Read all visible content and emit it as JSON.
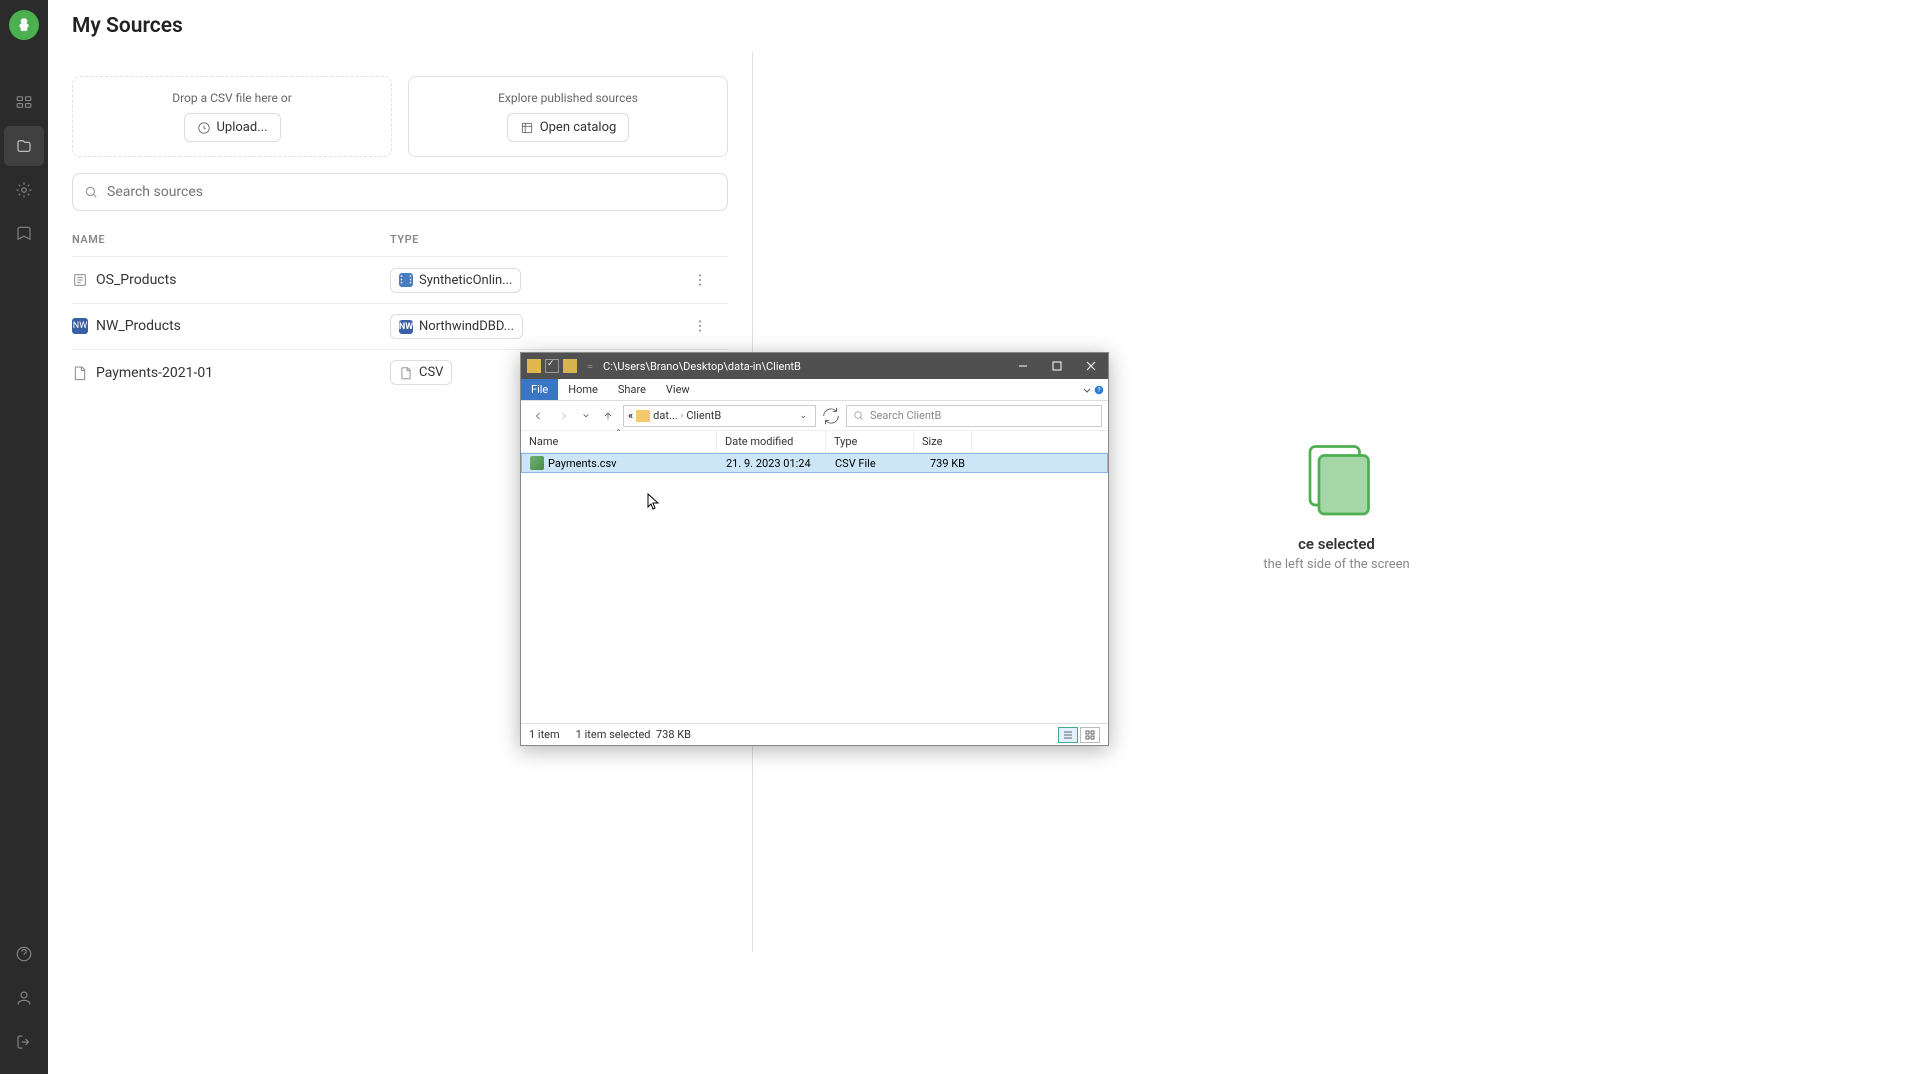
{
  "page": {
    "title": "My Sources"
  },
  "cards": {
    "drop_hint": "Drop a CSV file here or",
    "upload_label": "Upload...",
    "explore_hint": "Explore published sources",
    "catalog_label": "Open catalog"
  },
  "search": {
    "placeholder": "Search sources"
  },
  "table": {
    "headers": {
      "name": "NAME",
      "type": "TYPE"
    },
    "rows": [
      {
        "name": "OS_Products",
        "type_label": "SyntheticOnlin...",
        "type_kind": "db-blue"
      },
      {
        "name": "NW_Products",
        "type_label": "NorthwindDBD...",
        "type_kind": "db-dblue"
      },
      {
        "name": "Payments-2021-01",
        "type_label": "CSV",
        "type_kind": "csv"
      }
    ]
  },
  "right": {
    "no_selection_title_suffix": "ce selected",
    "no_selection_sub_suffix": "the left side of the screen"
  },
  "explorer": {
    "title_path": "C:\\Users\\Brano\\Desktop\\data-in\\ClientB",
    "ribbon": {
      "file": "File",
      "home": "Home",
      "share": "Share",
      "view": "View"
    },
    "breadcrumbs": {
      "sep_left": "«",
      "part1": "dat...",
      "part2": "ClientB"
    },
    "search_placeholder": "Search ClientB",
    "columns": {
      "name": "Name",
      "date": "Date modified",
      "type": "Type",
      "size": "Size"
    },
    "files": [
      {
        "name": "Payments.csv",
        "date": "21. 9. 2023 01:24",
        "type": "CSV File",
        "size": "739 KB"
      }
    ],
    "status": {
      "count": "1 item",
      "selected": "1 item selected",
      "sel_size": "738 KB"
    }
  }
}
